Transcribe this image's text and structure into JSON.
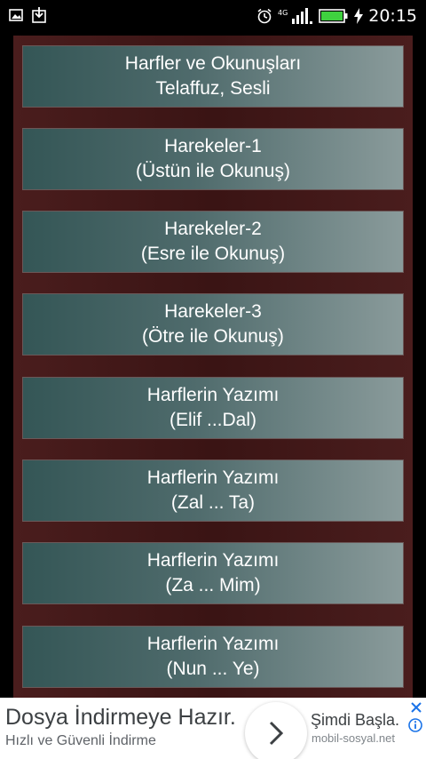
{
  "status_bar": {
    "time": "20:15",
    "network_label": "4G",
    "icons": [
      "image-icon",
      "download-icon",
      "alarm-icon",
      "signal-icon",
      "battery-icon",
      "charging-icon"
    ]
  },
  "menu": {
    "items": [
      {
        "line1": "Harfler ve Okunuşları",
        "line2": "Telaffuz, Sesli"
      },
      {
        "line1": "Harekeler-1",
        "line2": "(Üstün ile Okunuş)"
      },
      {
        "line1": "Harekeler-2",
        "line2": "(Esre ile Okunuş)"
      },
      {
        "line1": "Harekeler-3",
        "line2": "(Ötre ile Okunuş)"
      },
      {
        "line1": "Harflerin Yazımı",
        "line2": "(Elif ...Dal)"
      },
      {
        "line1": "Harflerin Yazımı",
        "line2": "(Zal ... Ta)"
      },
      {
        "line1": "Harflerin Yazımı",
        "line2": "(Za ... Mim)"
      },
      {
        "line1": "Harflerin Yazımı",
        "line2": "(Nun ... Ye)"
      }
    ]
  },
  "ad": {
    "title": "Dosya İndirmeye Hazır.",
    "subtitle": "Hızlı ve Güvenli İndirme",
    "cta": "Şimdi Başla.",
    "domain": "mobil-sosyal.net"
  },
  "colors": {
    "background": "#000000",
    "panel": "#3a1414",
    "button_left": "#345656",
    "button_right": "#8a9b9b",
    "battery": "#3fd13f",
    "ad_close": "#1a73e8"
  }
}
